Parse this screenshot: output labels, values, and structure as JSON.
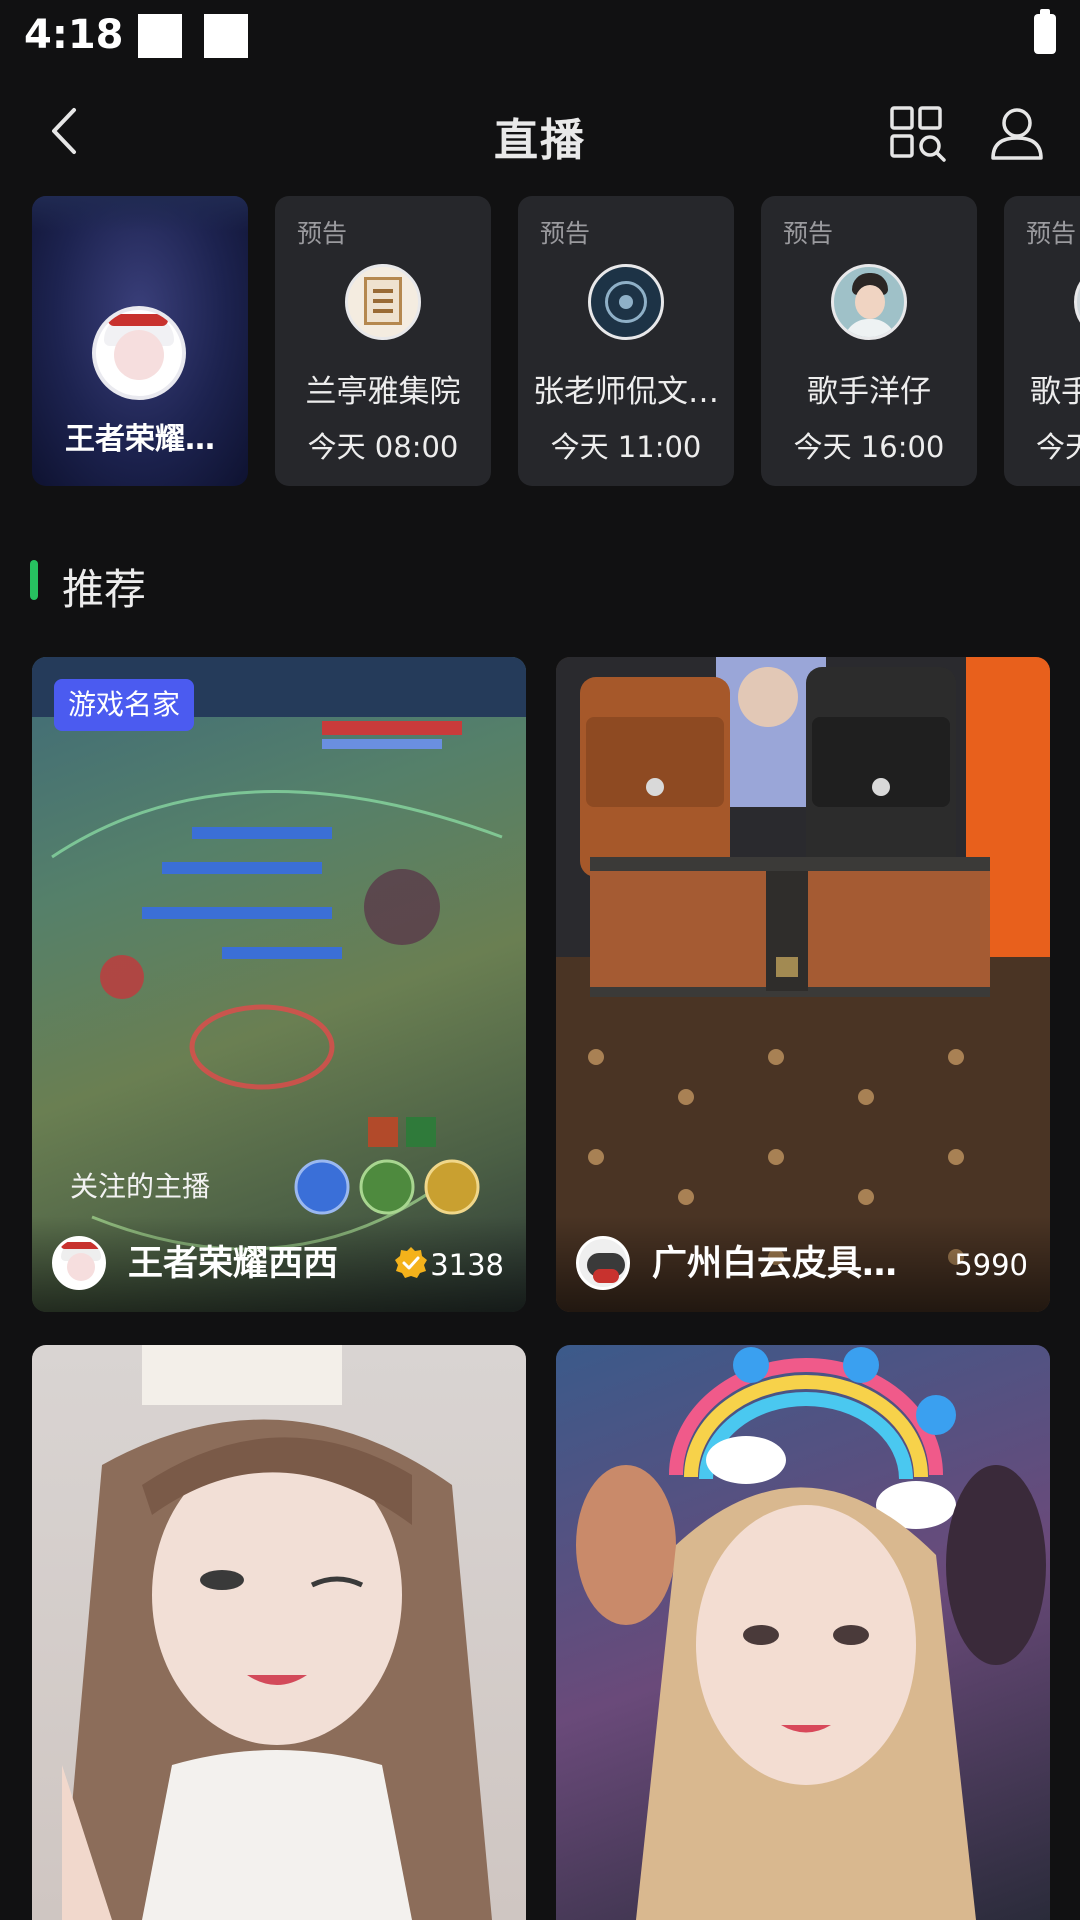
{
  "status_bar": {
    "time": "4:18"
  },
  "header": {
    "title": "直播"
  },
  "upcoming": {
    "live_card": {
      "name": "王者荣耀…"
    },
    "previews": [
      {
        "tag": "预告",
        "name": "兰亭雅集院",
        "time": "今天 08:00"
      },
      {
        "tag": "预告",
        "name": "张老师侃文…",
        "time": "今天 11:00"
      },
      {
        "tag": "预告",
        "name": "歌手洋仔",
        "time": "今天 16:00"
      },
      {
        "tag": "预告",
        "name": "歌手",
        "time": "今天"
      }
    ]
  },
  "section": {
    "title": "推荐"
  },
  "feed": [
    {
      "badge": "游戏名家",
      "overlay": "关注的主播",
      "name": "王者荣耀西西",
      "viewers": "3138"
    },
    {
      "name": "广州白云皮具…",
      "viewers": "5990"
    },
    {},
    {}
  ],
  "colors": {
    "accent_green": "#27c160",
    "badge_blue": "#4b5bf0",
    "background": "#111112",
    "card_bg": "#26272b"
  }
}
